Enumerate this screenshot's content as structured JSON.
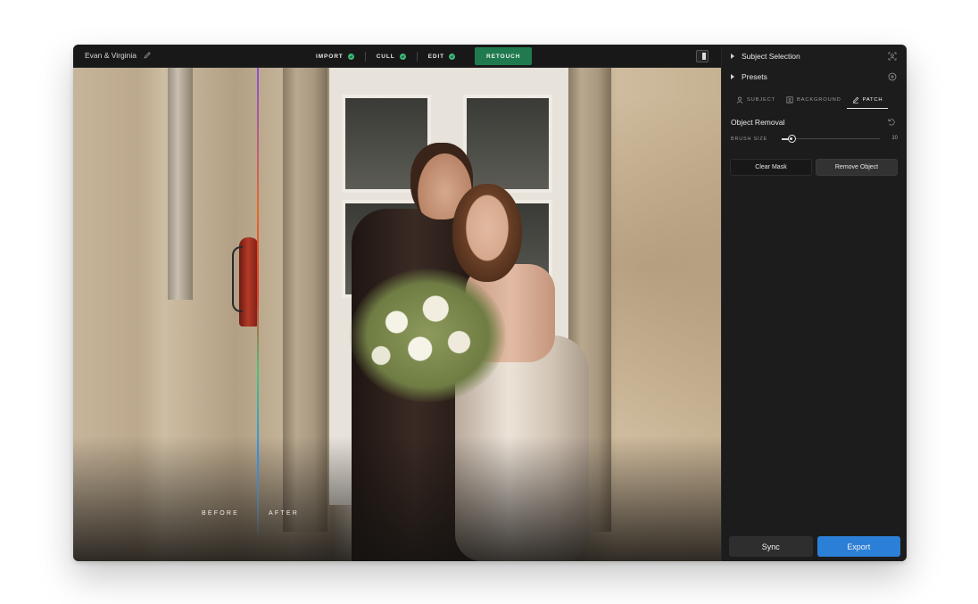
{
  "header": {
    "project_name": "Evan & Virginia",
    "steps": [
      {
        "label": "IMPORT",
        "done": true
      },
      {
        "label": "CULL",
        "done": true
      },
      {
        "label": "EDIT",
        "done": true
      },
      {
        "label": "RETOUCH",
        "active": true
      }
    ]
  },
  "canvas": {
    "before_label": "BEFORE",
    "after_label": "AFTER"
  },
  "panel": {
    "subject_selection": "Subject Selection",
    "presets": "Presets",
    "tabs": [
      {
        "label": "SUBJECT",
        "icon": "person-icon"
      },
      {
        "label": "BACKGROUND",
        "icon": "background-icon"
      },
      {
        "label": "PATCH",
        "icon": "patch-icon",
        "active": true
      }
    ],
    "object_removal": "Object Removal",
    "brush_size_label": "BRUSH SIZE",
    "brush_size_value": "10",
    "brush_size_fraction": 0.1,
    "clear_mask": "Clear Mask",
    "remove_object": "Remove Object",
    "sync": "Sync",
    "export": "Export"
  },
  "colors": {
    "accent_green": "#1f7a4f",
    "check_green": "#3fb979",
    "export_blue": "#2c7fd6"
  }
}
